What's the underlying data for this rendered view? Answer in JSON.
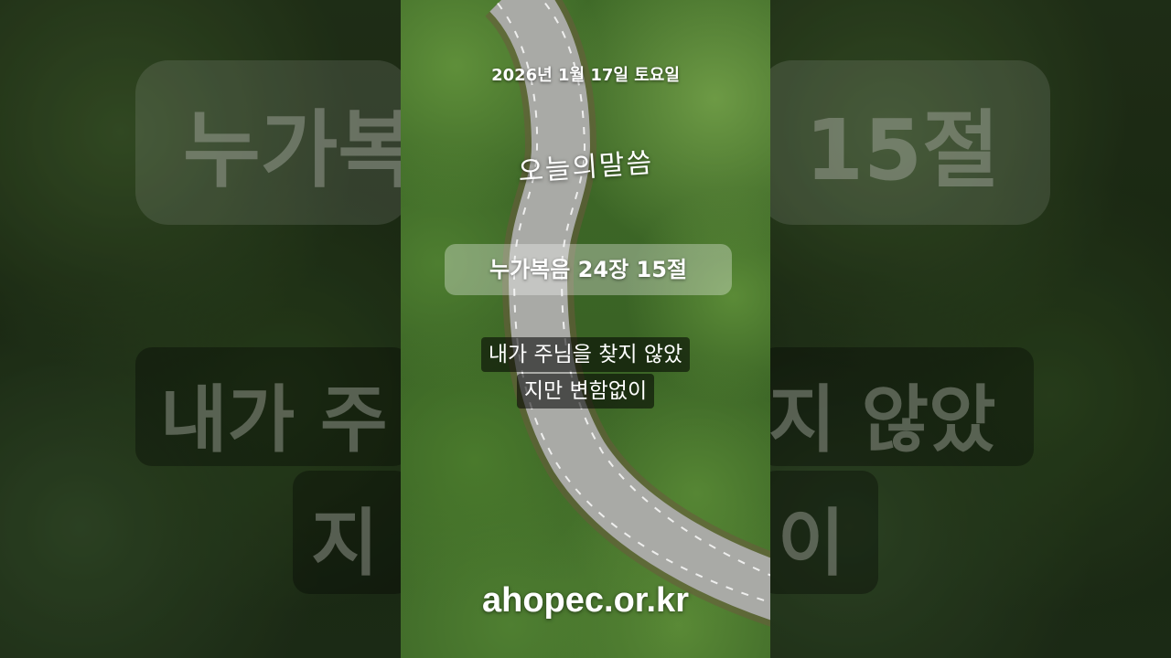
{
  "header": {
    "date": "2026년 1월 17일 토요일",
    "today_word": "오늘의말씀"
  },
  "scripture": {
    "reference": "누가복음 24장 15절",
    "lines": [
      "내가 주님을 찾지 않았",
      "지만 변함없이"
    ]
  },
  "footer": {
    "site": "ahopec.or.kr"
  },
  "background_ghost": {
    "left_top": "누가복",
    "right_top": "15절",
    "left_mid": "내가 주",
    "right_mid": "지 않았",
    "left_bottom": "지",
    "right_bottom": "이"
  },
  "colors": {
    "text": "#ffffff",
    "forest": "#4a7a2c",
    "road": "#a9aaa6"
  }
}
